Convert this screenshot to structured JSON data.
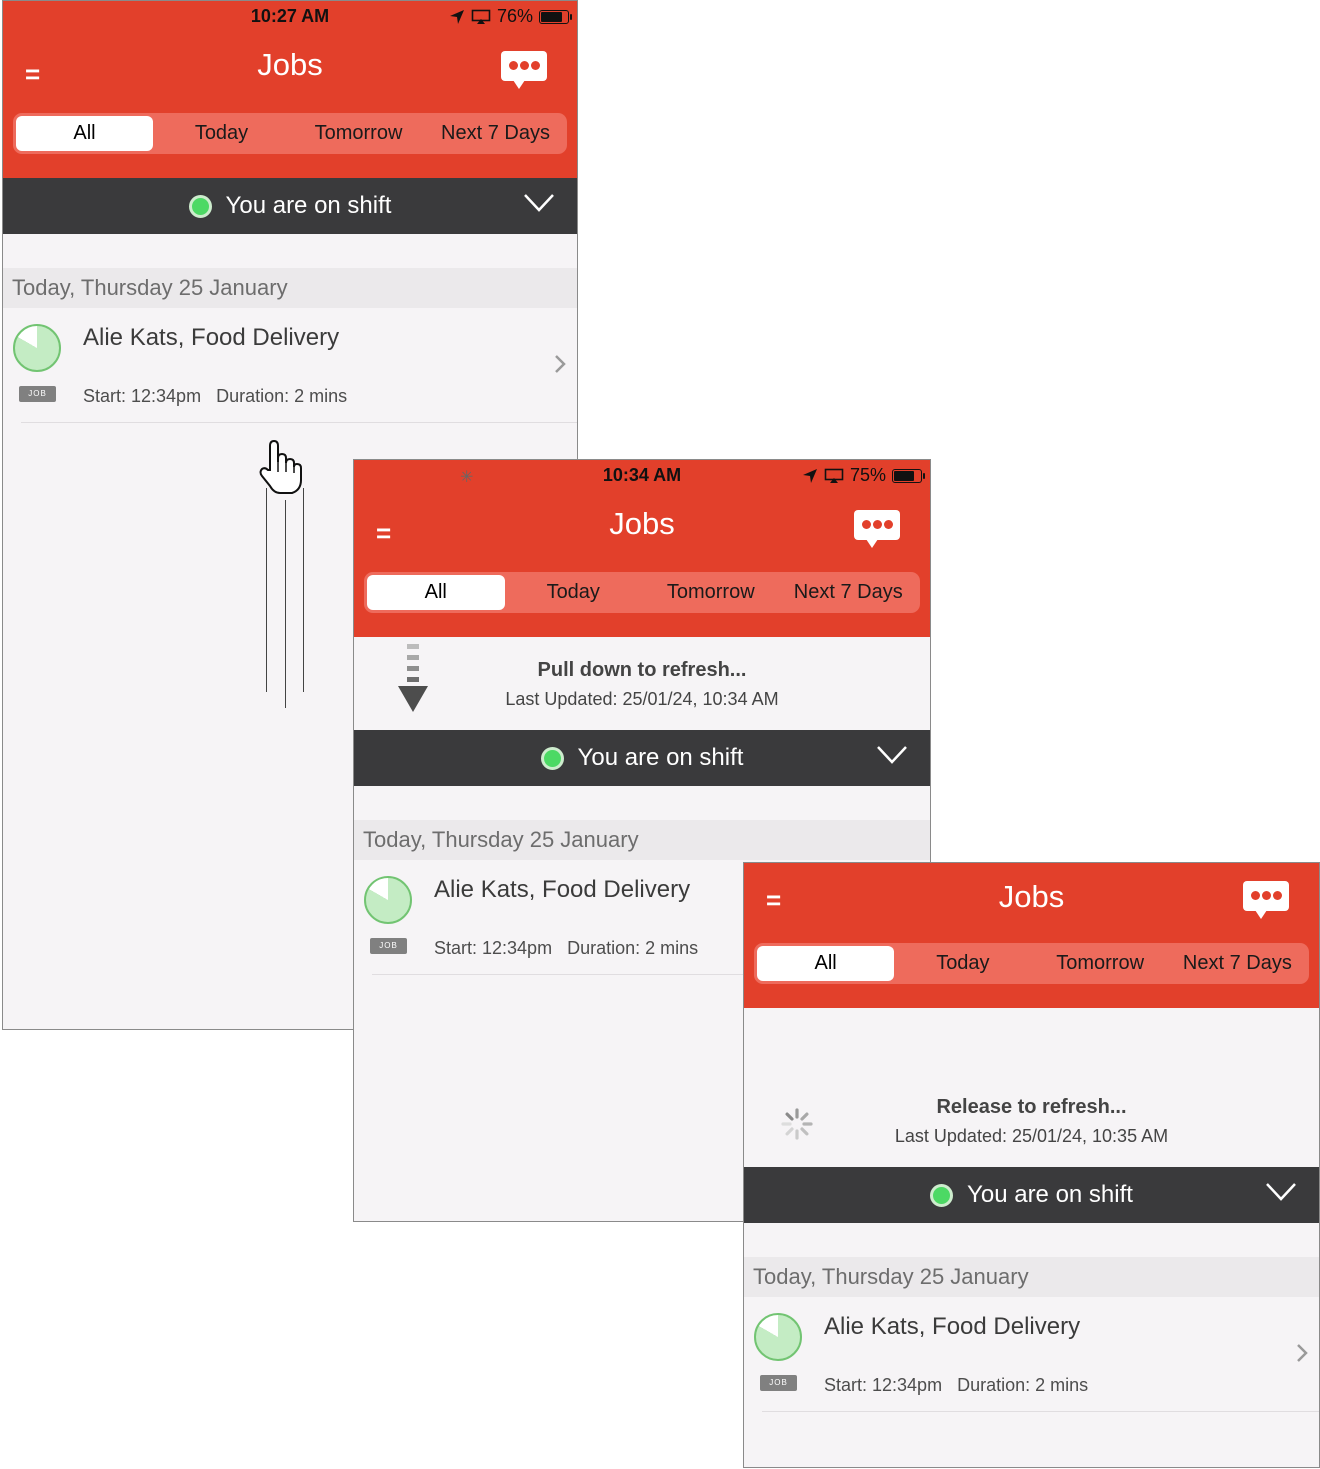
{
  "app": {
    "title": "Jobs",
    "tabs": [
      "All",
      "Today",
      "Tomorrow",
      "Next 7 Days"
    ],
    "shift_text": "You are on shift",
    "date_header": "Today, Thursday 25 January",
    "job": {
      "name": "Alie Kats, Food Delivery",
      "badge": "JOB",
      "start": "Start: 12:34pm",
      "duration": "Duration: 2 mins"
    }
  },
  "screen1": {
    "time": "10:27 AM",
    "battery": "76%",
    "battery_level": 0.76
  },
  "screen2": {
    "time": "10:34 AM",
    "battery": "75%",
    "battery_level": 0.75,
    "refresh_title": "Pull down to refresh...",
    "refresh_updated": "Last Updated: 25/01/24, 10:34 AM"
  },
  "screen3": {
    "refresh_title": "Release to refresh...",
    "refresh_updated": "Last Updated: 25/01/24, 10:35 AM"
  },
  "colors": {
    "header": "#e2402b",
    "shift_bar": "#3a3a3c",
    "on_shift_dot": "#4cd964"
  }
}
